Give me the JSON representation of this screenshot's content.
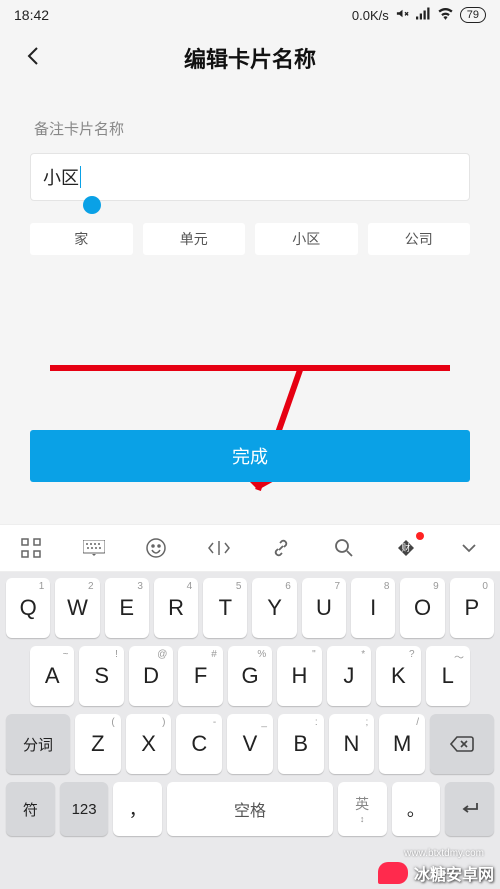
{
  "status": {
    "time": "18:42",
    "net_speed": "0.0K/s",
    "battery": "79"
  },
  "header": {
    "title": "编辑卡片名称"
  },
  "form": {
    "label": "备注卡片名称",
    "input_value": "小区",
    "chips": [
      "家",
      "单元",
      "小区",
      "公司"
    ],
    "done_label": "完成"
  },
  "keyboard": {
    "row1": [
      {
        "k": "Q",
        "s": "1"
      },
      {
        "k": "W",
        "s": "2"
      },
      {
        "k": "E",
        "s": "3"
      },
      {
        "k": "R",
        "s": "4"
      },
      {
        "k": "T",
        "s": "5"
      },
      {
        "k": "Y",
        "s": "6"
      },
      {
        "k": "U",
        "s": "7"
      },
      {
        "k": "I",
        "s": "8"
      },
      {
        "k": "O",
        "s": "9"
      },
      {
        "k": "P",
        "s": "0"
      }
    ],
    "row2": [
      {
        "k": "A",
        "s": "~"
      },
      {
        "k": "S",
        "s": "!"
      },
      {
        "k": "D",
        "s": "@"
      },
      {
        "k": "F",
        "s": "#"
      },
      {
        "k": "G",
        "s": "%"
      },
      {
        "k": "H",
        "s": "\""
      },
      {
        "k": "J",
        "s": "*"
      },
      {
        "k": "K",
        "s": "?"
      },
      {
        "k": "L",
        "s": "～"
      }
    ],
    "row3_seg": "分词",
    "row3": [
      {
        "k": "Z",
        "s": "("
      },
      {
        "k": "X",
        "s": ")"
      },
      {
        "k": "C",
        "s": "-"
      },
      {
        "k": "V",
        "s": "_"
      },
      {
        "k": "B",
        "s": ":"
      },
      {
        "k": "N",
        "s": ";"
      },
      {
        "k": "M",
        "s": "/"
      }
    ],
    "row4": {
      "sym": "符",
      "num": "123",
      "comma": "，",
      "space": "空格",
      "lang": "英",
      "period": "。"
    }
  },
  "watermark": {
    "brand": "冰糖安卓网",
    "url": "www.btxtdmy.com"
  }
}
